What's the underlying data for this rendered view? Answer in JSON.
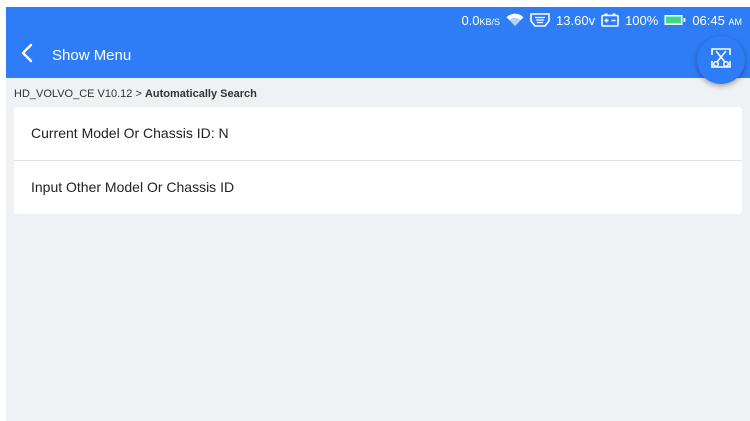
{
  "status_bar": {
    "net_speed_value": "0.0",
    "net_speed_unit": "KB/S",
    "voltage": "13.60v",
    "battery_percent": "100%",
    "time": "06:45",
    "time_suffix": "AM",
    "icons": [
      "wifi-icon",
      "vci-icon",
      "car-battery-icon",
      "battery-icon"
    ]
  },
  "header": {
    "title": "Show Menu",
    "icons": [
      "back-arrow-icon",
      "scissors-icon"
    ]
  },
  "breadcrumb": {
    "path": "HD_VOLVO_CE V10.12 > ",
    "current": "Automatically Search"
  },
  "list": {
    "items": [
      {
        "label": "Current Model Or Chassis ID: N"
      },
      {
        "label": "Input Other Model Or Chassis ID"
      }
    ]
  },
  "colors": {
    "primary": "#2f7df6",
    "background": "#f0f1f5",
    "card": "#ffffff",
    "battery_fill": "#3ddc84"
  }
}
